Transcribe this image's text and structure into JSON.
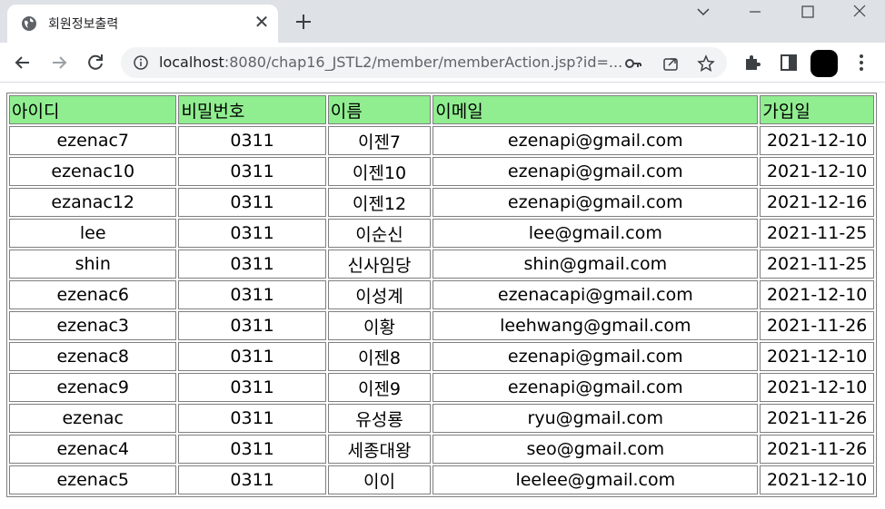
{
  "tab": {
    "title": "회원정보출력",
    "close_glyph": "✕"
  },
  "url": {
    "host": "localhost",
    "rest": ":8080/chap16_JSTL2/member/memberAction.jsp?id=..."
  },
  "table": {
    "headers": [
      "아이디",
      "비밀번호",
      "이름",
      "이메일",
      "가입일"
    ],
    "rows": [
      [
        "ezenac7",
        "0311",
        "이젠7",
        "ezenapi@gmail.com",
        "2021-12-10"
      ],
      [
        "ezenac10",
        "0311",
        "이젠10",
        "ezenapi@gmail.com",
        "2021-12-10"
      ],
      [
        "ezanac12",
        "0311",
        "이젠12",
        "ezenapi@gmail.com",
        "2021-12-16"
      ],
      [
        "lee",
        "0311",
        "이순신",
        "lee@gmail.com",
        "2021-11-25"
      ],
      [
        "shin",
        "0311",
        "신사임당",
        "shin@gmail.com",
        "2021-11-25"
      ],
      [
        "ezenac6",
        "0311",
        "이성계",
        "ezenacapi@gmail.com",
        "2021-12-10"
      ],
      [
        "ezenac3",
        "0311",
        "이황",
        "leehwang@gmail.com",
        "2021-11-26"
      ],
      [
        "ezenac8",
        "0311",
        "이젠8",
        "ezenapi@gmail.com",
        "2021-12-10"
      ],
      [
        "ezenac9",
        "0311",
        "이젠9",
        "ezenapi@gmail.com",
        "2021-12-10"
      ],
      [
        "ezenac",
        "0311",
        "유성룡",
        "ryu@gmail.com",
        "2021-11-26"
      ],
      [
        "ezenac4",
        "0311",
        "세종대왕",
        "seo@gmail.com",
        "2021-11-26"
      ],
      [
        "ezenac5",
        "0311",
        "이이",
        "leelee@gmail.com",
        "2021-12-10"
      ]
    ]
  },
  "colors": {
    "header_bg": "#90ee90",
    "chrome_bg": "#dee1e6",
    "omnibox_bg": "#f1f3f4"
  },
  "icons": [
    "globe-icon",
    "close-icon",
    "plus-icon",
    "chevron-down-icon",
    "minimize-icon",
    "maximize-icon",
    "window-close-icon",
    "back-icon",
    "forward-icon",
    "reload-icon",
    "info-icon",
    "key-icon",
    "share-icon",
    "star-icon",
    "extensions-icon",
    "side-panel-icon",
    "menu-icon"
  ]
}
